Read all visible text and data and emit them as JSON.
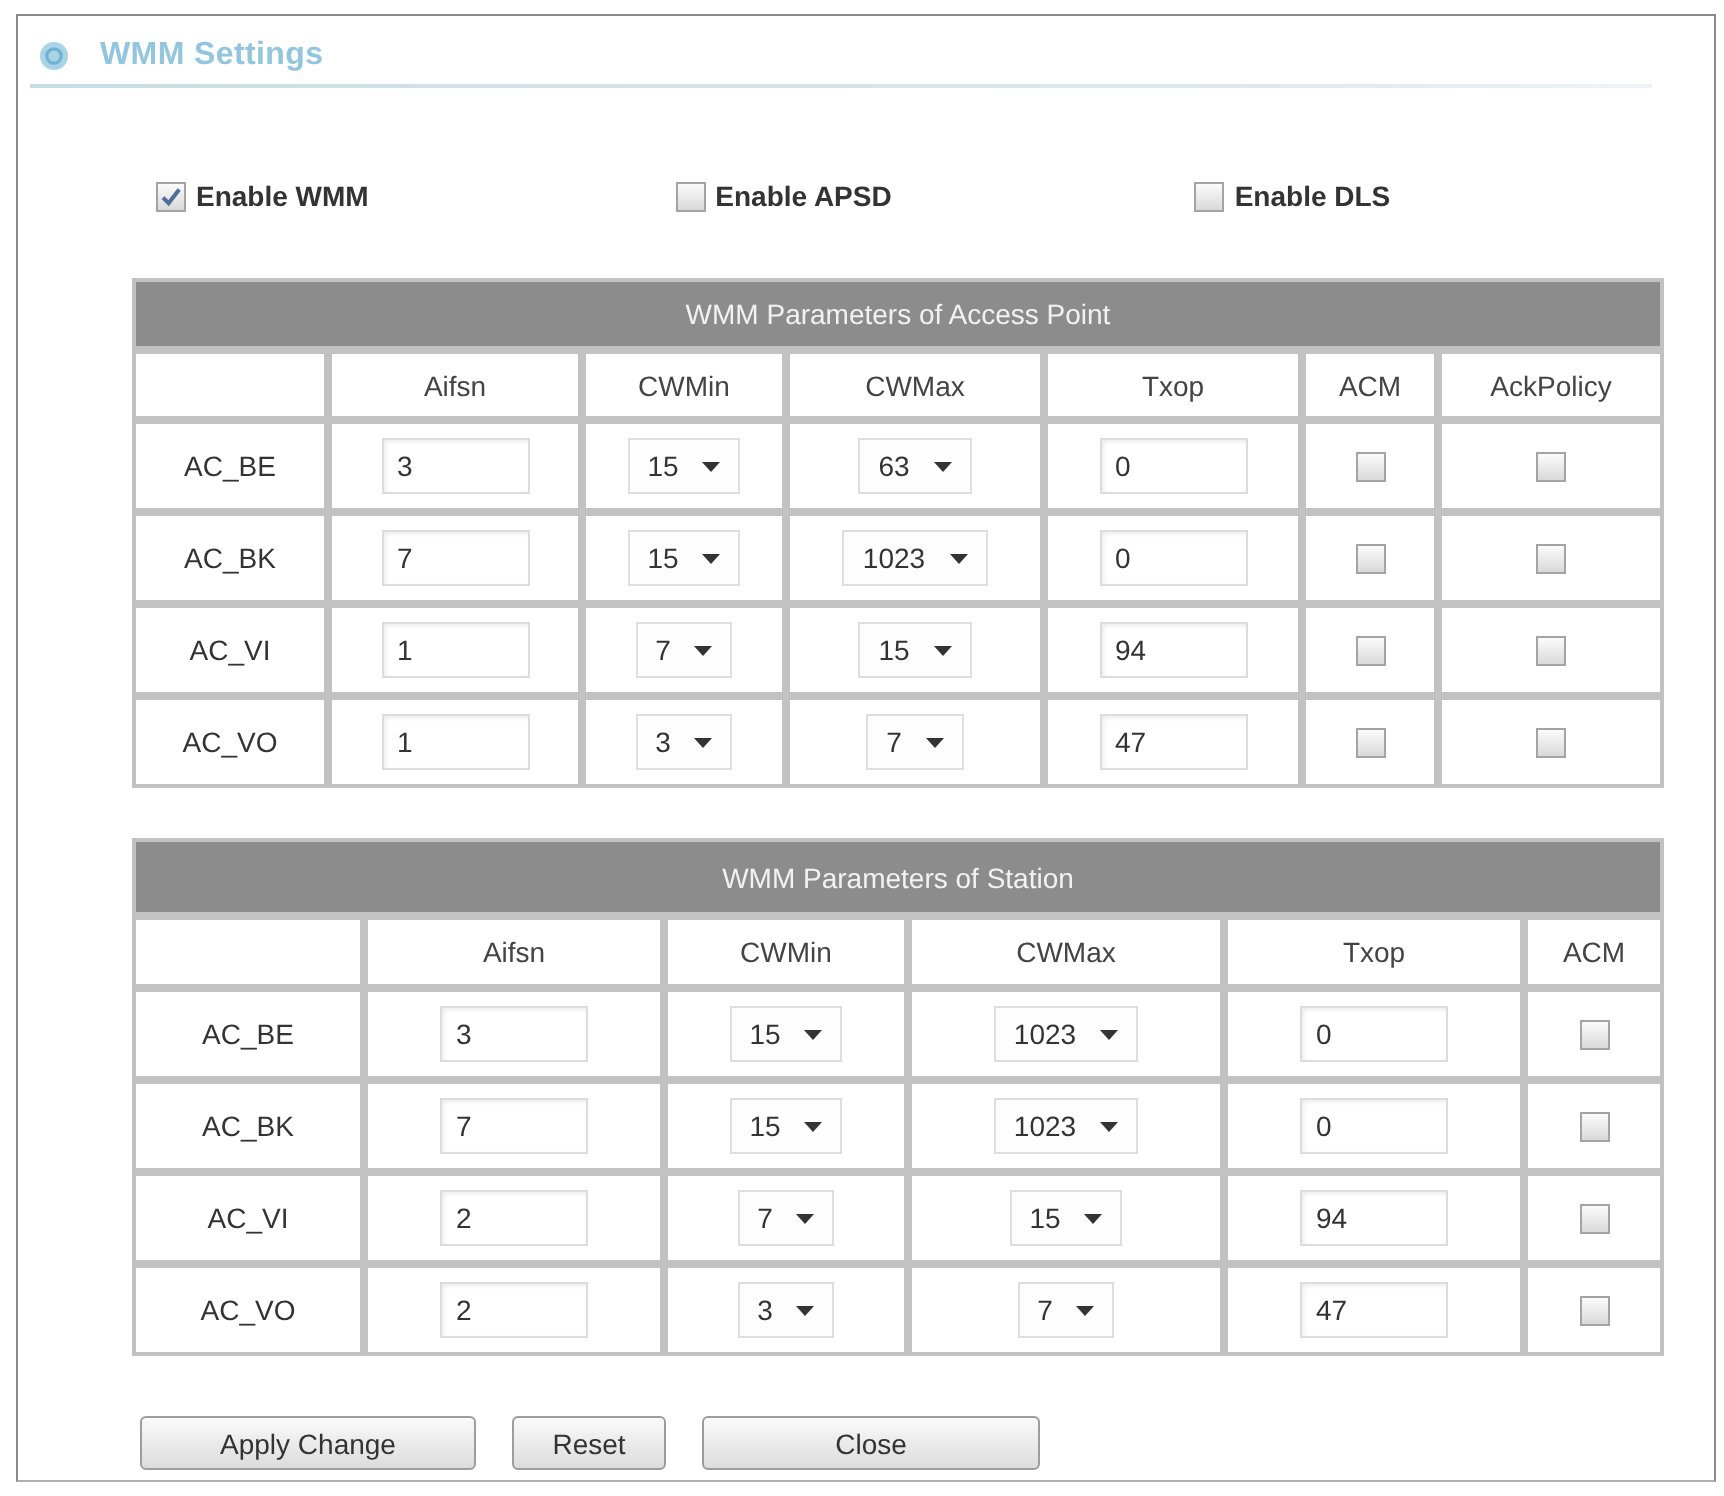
{
  "window": {
    "title": "WMM Settings"
  },
  "options": [
    {
      "label": "Enable WMM",
      "checked": true
    },
    {
      "label": "Enable APSD",
      "checked": false
    },
    {
      "label": "Enable DLS",
      "checked": false
    }
  ],
  "tables": [
    {
      "title": "WMM Parameters of Access Point",
      "columns": [
        "Aifsn",
        "CWMin",
        "CWMax",
        "Txop",
        "ACM",
        "AckPolicy"
      ],
      "rows": [
        {
          "name": "AC_BE",
          "cells": [
            {
              "kind": "text",
              "value": "3"
            },
            {
              "kind": "select",
              "value": "15"
            },
            {
              "kind": "select",
              "value": "63"
            },
            {
              "kind": "text",
              "value": "0"
            },
            {
              "kind": "checkbox",
              "checked": false
            },
            {
              "kind": "checkbox",
              "checked": false
            }
          ]
        },
        {
          "name": "AC_BK",
          "cells": [
            {
              "kind": "text",
              "value": "7"
            },
            {
              "kind": "select",
              "value": "15"
            },
            {
              "kind": "select",
              "value": "1023"
            },
            {
              "kind": "text",
              "value": "0"
            },
            {
              "kind": "checkbox",
              "checked": false
            },
            {
              "kind": "checkbox",
              "checked": false
            }
          ]
        },
        {
          "name": "AC_VI",
          "cells": [
            {
              "kind": "text",
              "value": "1"
            },
            {
              "kind": "select",
              "value": "7"
            },
            {
              "kind": "select",
              "value": "15"
            },
            {
              "kind": "text",
              "value": "94"
            },
            {
              "kind": "checkbox",
              "checked": false
            },
            {
              "kind": "checkbox",
              "checked": false
            }
          ]
        },
        {
          "name": "AC_VO",
          "cells": [
            {
              "kind": "text",
              "value": "1"
            },
            {
              "kind": "select",
              "value": "3"
            },
            {
              "kind": "select",
              "value": "7"
            },
            {
              "kind": "text",
              "value": "47"
            },
            {
              "kind": "checkbox",
              "checked": false
            },
            {
              "kind": "checkbox",
              "checked": false
            }
          ]
        }
      ]
    },
    {
      "title": "WMM Parameters of Station",
      "columns": [
        "Aifsn",
        "CWMin",
        "CWMax",
        "Txop",
        "ACM"
      ],
      "rows": [
        {
          "name": "AC_BE",
          "cells": [
            {
              "kind": "text",
              "value": "3"
            },
            {
              "kind": "select",
              "value": "15"
            },
            {
              "kind": "select",
              "value": "1023"
            },
            {
              "kind": "text",
              "value": "0"
            },
            {
              "kind": "checkbox",
              "checked": false
            }
          ]
        },
        {
          "name": "AC_BK",
          "cells": [
            {
              "kind": "text",
              "value": "7"
            },
            {
              "kind": "select",
              "value": "15"
            },
            {
              "kind": "select",
              "value": "1023"
            },
            {
              "kind": "text",
              "value": "0"
            },
            {
              "kind": "checkbox",
              "checked": false
            }
          ]
        },
        {
          "name": "AC_VI",
          "cells": [
            {
              "kind": "text",
              "value": "2"
            },
            {
              "kind": "select",
              "value": "7"
            },
            {
              "kind": "select",
              "value": "15"
            },
            {
              "kind": "text",
              "value": "94"
            },
            {
              "kind": "checkbox",
              "checked": false
            }
          ]
        },
        {
          "name": "AC_VO",
          "cells": [
            {
              "kind": "text",
              "value": "2"
            },
            {
              "kind": "select",
              "value": "3"
            },
            {
              "kind": "select",
              "value": "7"
            },
            {
              "kind": "text",
              "value": "47"
            },
            {
              "kind": "checkbox",
              "checked": false
            }
          ]
        }
      ]
    }
  ],
  "buttons": [
    "Apply Change",
    "Reset",
    "Close"
  ]
}
